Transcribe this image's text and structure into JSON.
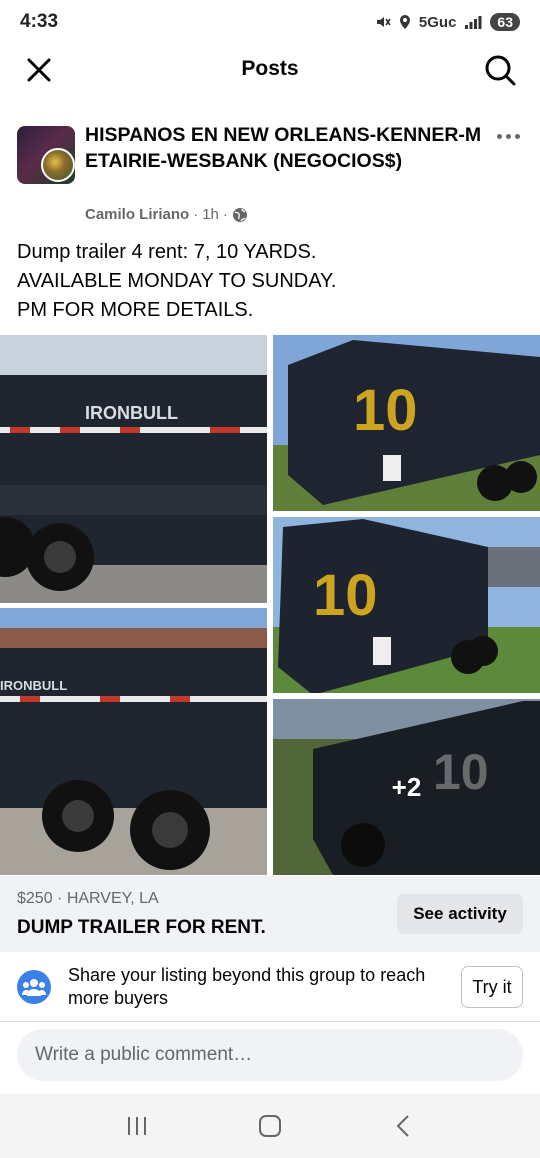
{
  "status_bar": {
    "time": "4:33",
    "network": "5Guc",
    "battery": "63"
  },
  "header": {
    "title": "Posts"
  },
  "post": {
    "group_name": "HISPANOS EN NEW ORLEANS-KENNER-METAIRIE-WESBANK (NEGOCIOS$)",
    "author": "Camilo Liriano",
    "time": "1h",
    "text_lines": [
      "Dump trailer 4 rent: 7, 10 YARDS.",
      "AVAILABLE MONDAY TO SUNDAY.",
      "PM FOR MORE DETAILS."
    ],
    "photos": {
      "brand_text": "IRONBULL",
      "more_count": "+2"
    }
  },
  "listing": {
    "price_location": "$250 · HARVEY, LA",
    "title": "DUMP TRAILER FOR RENT.",
    "see_activity_label": "See activity"
  },
  "share": {
    "text": "Share your listing beyond this group to reach more buyers",
    "button_label": "Try it"
  },
  "comment": {
    "placeholder": "Write a public comment…"
  },
  "icons": {
    "close": "close-icon",
    "search": "search-icon",
    "more": "more-icon",
    "globe": "globe-icon",
    "group": "group-icon"
  }
}
